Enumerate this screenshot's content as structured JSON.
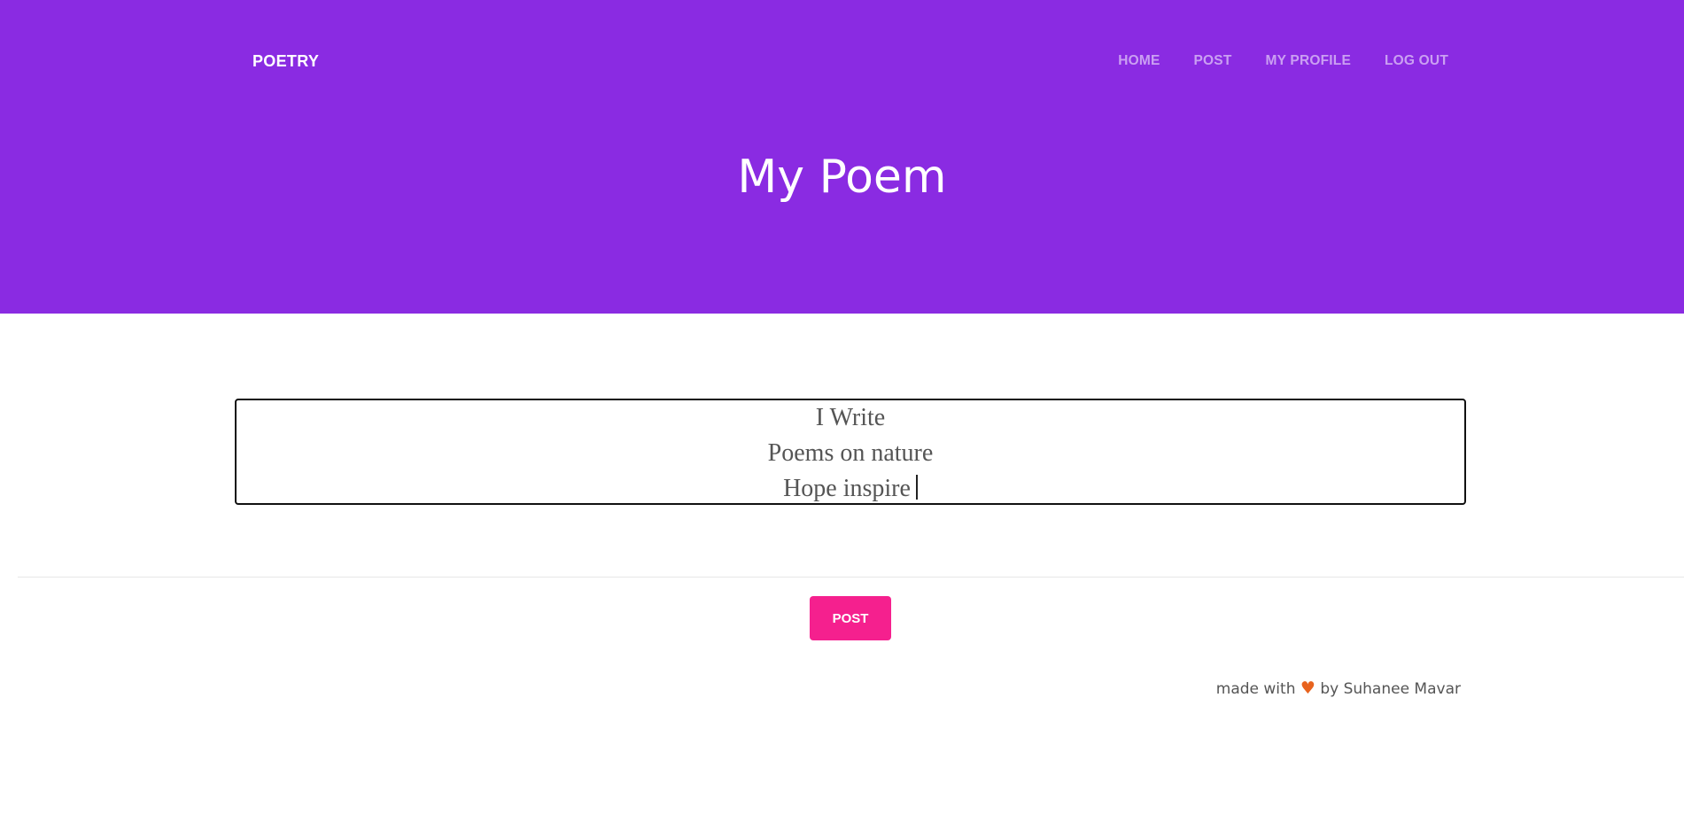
{
  "header": {
    "brand": "POETRY",
    "nav": [
      {
        "label": "HOME"
      },
      {
        "label": "POST"
      },
      {
        "label": "MY PROFILE"
      },
      {
        "label": "LOG OUT"
      }
    ],
    "title": "My Poem"
  },
  "poem": {
    "lines": [
      "I Write",
      "Poems on nature",
      "Hope inspire"
    ]
  },
  "actions": {
    "post_label": "POST"
  },
  "footer": {
    "prefix": "made with",
    "heart": "♥",
    "suffix": "by Suhanee Mavar"
  },
  "colors": {
    "header_bg": "#8a2be2",
    "post_button": "#f5208e",
    "heart": "#e8631e"
  }
}
